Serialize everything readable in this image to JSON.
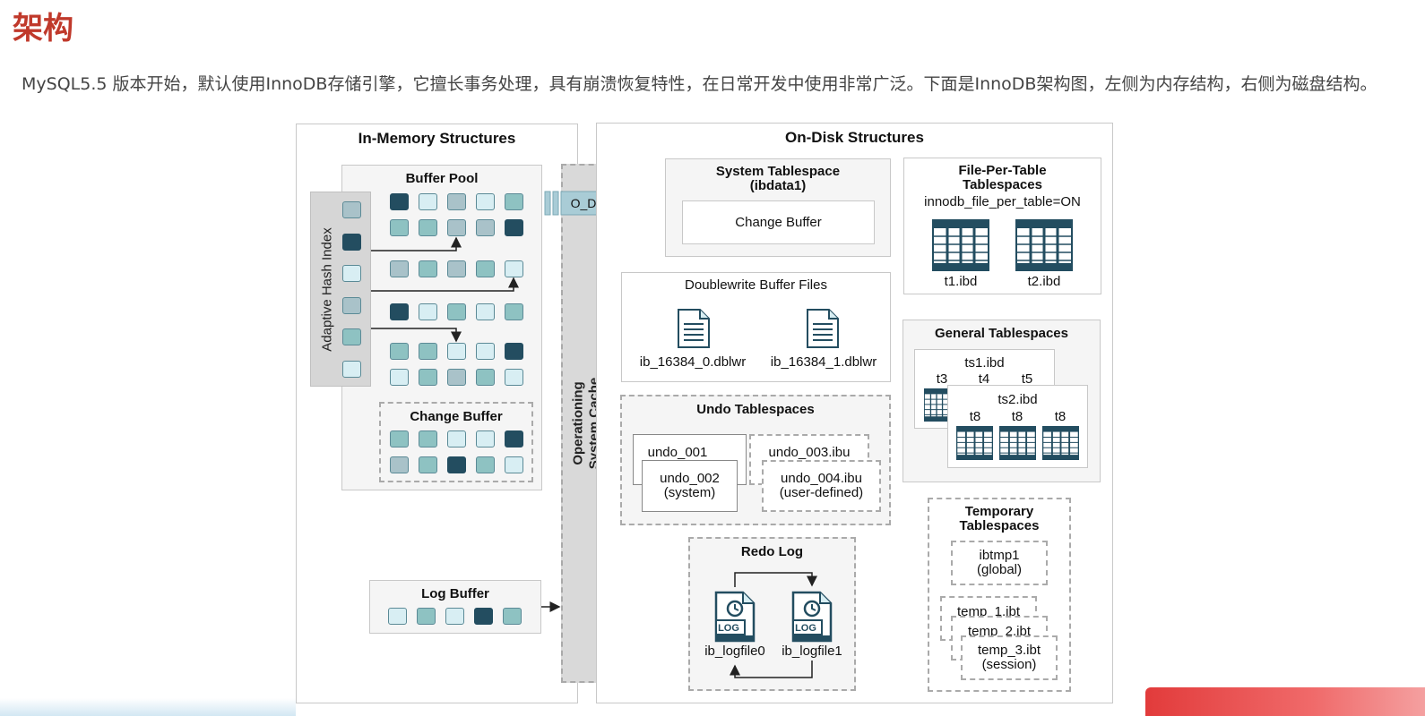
{
  "page": {
    "heading": "架构",
    "intro": "MySQL5.5 版本开始，默认使用InnoDB存储引擎，它擅长事务处理，具有崩溃恢复特性，在日常开发中使用非常广泛。下面是InnoDB架构图，左侧为内存结构，右侧为磁盘结构。"
  },
  "diagram": {
    "in_memory": {
      "title": "In-Memory Structures",
      "buffer_pool": "Buffer Pool",
      "adaptive_hash_index": "Adaptive Hash Index",
      "change_buffer": "Change Buffer",
      "log_buffer": "Log Buffer"
    },
    "os_cache": {
      "line1": "Operationing",
      "line2": "System Cache"
    },
    "o_direct": "O_DIRECT",
    "on_disk": {
      "title": "On-Disk Structures",
      "system_tablespace": {
        "title_line1": "System Tablespace",
        "title_line2": "(ibdata1)",
        "change_buffer": "Change Buffer"
      },
      "file_per_table": {
        "title_line1": "File-Per-Table",
        "title_line2": "Tablespaces",
        "setting": "innodb_file_per_table=ON",
        "files": [
          "t1.ibd",
          "t2.ibd"
        ]
      },
      "doublewrite": {
        "title": "Doublewrite Buffer Files",
        "files": [
          "ib_16384_0.dblwr",
          "ib_16384_1.dblwr"
        ]
      },
      "general_tablespaces": {
        "title": "General Tablespaces",
        "ts1": "ts1.ibd",
        "ts1_tables": [
          "t3",
          "t4",
          "t5"
        ],
        "ts2": "ts2.ibd",
        "ts2_tables": [
          "t8",
          "t8",
          "t8"
        ]
      },
      "undo": {
        "title": "Undo Tablespaces",
        "undo_001": "undo_001",
        "undo_002_line1": "undo_002",
        "undo_002_line2": "(system)",
        "undo_003": "undo_003.ibu",
        "undo_004_line1": "undo_004.ibu",
        "undo_004_line2": "(user-defined)"
      },
      "redo": {
        "title": "Redo Log",
        "files": [
          "ib_logfile0",
          "ib_logfile1"
        ],
        "icon_label": "LOG"
      },
      "temporary": {
        "title_line1": "Temporary",
        "title_line2": "Tablespaces",
        "global_line1": "ibtmp1",
        "global_line2": "(global)",
        "temp1": "temp_1.ibt",
        "temp2": "temp_2.ibt",
        "temp3_line1": "temp_3.ibt",
        "temp3_line2": "(session)"
      }
    },
    "colors": {
      "dark_teal": "#234d60",
      "mid_teal": "#8ec2c2",
      "light_teal": "#d8eef3",
      "arrow_blue": "#a9ccd6",
      "accent_red": "#c0392b"
    }
  }
}
